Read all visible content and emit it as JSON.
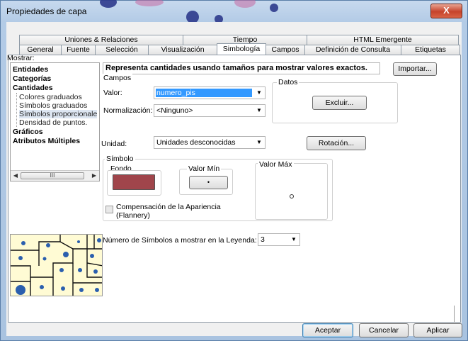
{
  "window": {
    "title": "Propiedades de capa",
    "close_glyph": "X"
  },
  "tabs_top": [
    "Uniones & Relaciones",
    "Tiempo",
    "HTML Emergente"
  ],
  "tabs_bottom": [
    "General",
    "Fuente",
    "Selección",
    "Visualización",
    "Simbología",
    "Campos",
    "Definición de Consulta",
    "Etiquetas"
  ],
  "active_tab": "Simbología",
  "show": {
    "label": "Mostrar:",
    "items": [
      {
        "label": "Entidades",
        "level": 0
      },
      {
        "label": "Categorías",
        "level": 0
      },
      {
        "label": "Cantidades",
        "level": 0
      },
      {
        "label": "Colores graduados",
        "level": 1
      },
      {
        "label": "Símbolos graduados",
        "level": 1
      },
      {
        "label": "Símbolos proporcionale",
        "level": 1,
        "selected": true
      },
      {
        "label": "Densidad de puntos.",
        "level": 1
      },
      {
        "label": "Gráficos",
        "level": 0
      },
      {
        "label": "Atributos Múltiples",
        "level": 0
      }
    ],
    "scroll_thumb": "III"
  },
  "description": "Representa cantidades usando tamaños para mostrar valores exactos.",
  "import_button": "Importar...",
  "fields": {
    "group_title": "Campos",
    "value_label": "Valor:",
    "value": "numero_pis",
    "normalization_label": "Normalización:",
    "normalization": "<Ninguno>"
  },
  "data_group": {
    "title": "Datos",
    "exclude_button": "Excluir..."
  },
  "unit": {
    "label": "Unidad:",
    "value": "Unidades desconocidas"
  },
  "rotation_button": "Rotación...",
  "symbol": {
    "group_title": "Símbolo",
    "background_label": "Fondo",
    "min_label": "Valor Mín",
    "max_label": "Valor Máx",
    "background_color": "#a0454b",
    "appearance_line1": "Compensación de la Apariencia",
    "appearance_line2": "(Flannery)"
  },
  "legend": {
    "label": "Número de Símbolos a mostrar en la Leyenda:",
    "value": "3"
  },
  "buttons": {
    "accept": "Aceptar",
    "cancel": "Cancelar",
    "apply": "Aplicar"
  },
  "colors": {
    "selection": "#3399ff",
    "panel_bg": "#ffffff",
    "preview_bg": "#fffbd4",
    "dot": "#2b5fae"
  }
}
